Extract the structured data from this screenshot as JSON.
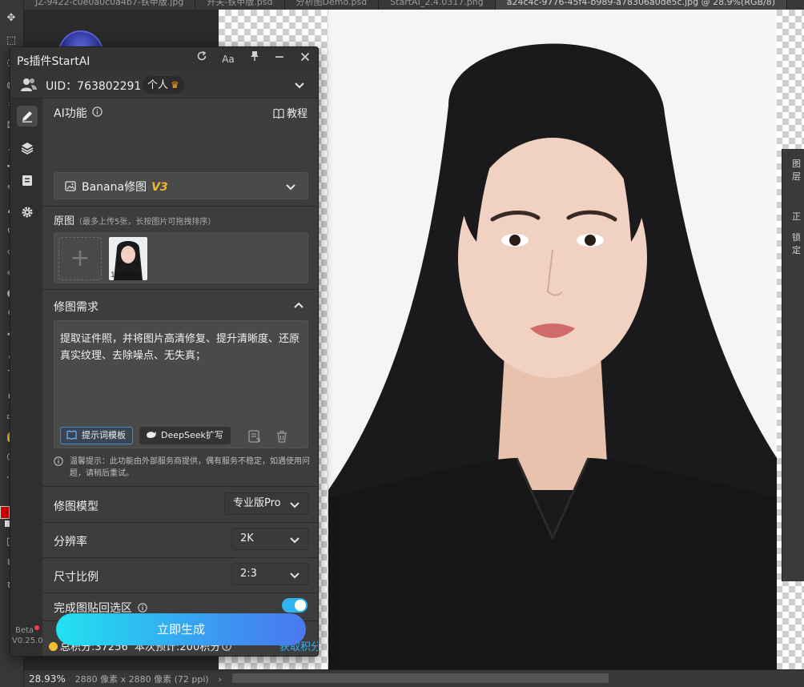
{
  "ps": {
    "tabs": [
      "JZ-9422-c0e0a0c0a4b7-铁甲版.jpg",
      "开关-铁甲版.psd",
      "分析图Demo.psd",
      "StartAI_2.4.0317.png",
      "a24c4c-9776-45f4-b989-a78306a0de5c.jpg @ 28.9%(RGB/8)"
    ],
    "status": {
      "zoom": "28.93%",
      "info": "2880 像素 x 2880 像素 (72 ppi)",
      "arrow": "›"
    },
    "right_panel_labels": [
      "图层",
      "正",
      "锁定"
    ]
  },
  "plugin": {
    "title": "Ps插件StartAI",
    "title_buttons": [
      "refresh-icon",
      "font-size-icon",
      "pin-icon",
      "minimize-icon",
      "close-icon"
    ],
    "font_btn": "Aa",
    "uid": "UID：763802291",
    "badge": "个人",
    "version_line1": "Beta",
    "version_line2": "V0.25.0",
    "ai_function_label": "AI功能",
    "tutorial": "教程",
    "model_select": {
      "name": "Banana修图",
      "tag": "V3"
    },
    "source_label": "原图",
    "source_hint": "（最多上传5张，长按图片可拖拽排序）",
    "thumb_index": "1",
    "request_label": "修图需求",
    "request_text": "提取证件照，并将图片高清修复、提升清晰度、还原真实纹理、去除噪点、无失真；",
    "chip_template": "提示词模板",
    "chip_deepseek": "DeepSeek扩写",
    "tip": "温馨提示：此功能由外部服务商提供，偶有服务不稳定，如遇使用问题，请稍后重试。",
    "fields": [
      {
        "label": "修图模型",
        "value": "专业版Pro"
      },
      {
        "label": "分辨率",
        "value": "2K"
      },
      {
        "label": "尺寸比例",
        "value": "2:3"
      }
    ],
    "paste_back_label": "完成图贴回选区",
    "paste_back_on": true,
    "credits_total": "总积分:37256",
    "credits_estimate": "本次预计:200积分",
    "get_credits": "获取积分",
    "generate": "立即生成",
    "accent": "#2fb6f0",
    "tag_color": "#f2b632"
  }
}
